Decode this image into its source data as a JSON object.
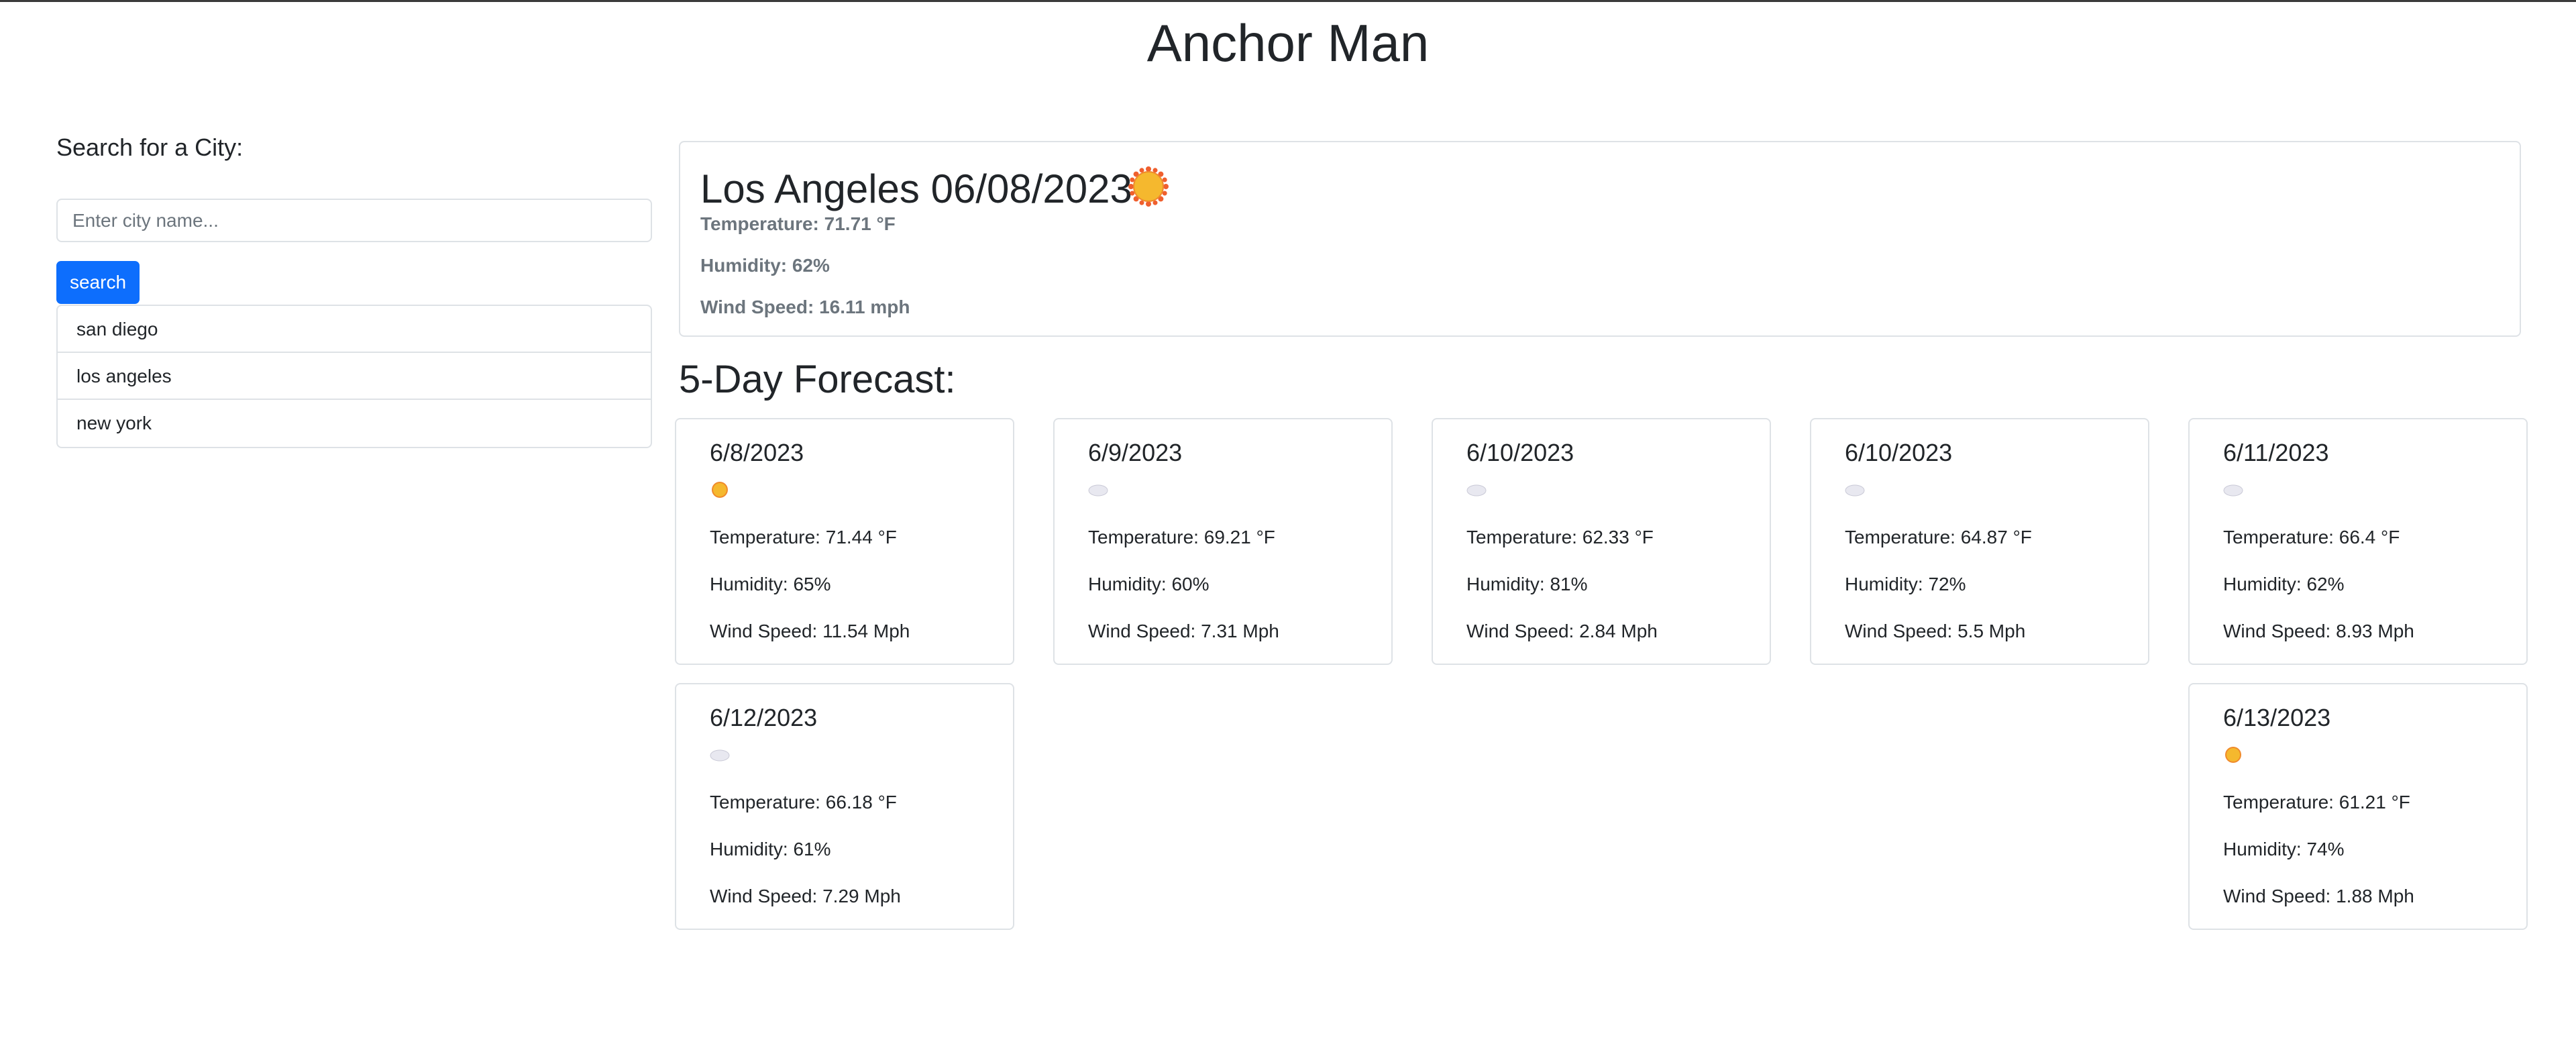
{
  "app": {
    "title": "Anchor Man"
  },
  "sidebar": {
    "heading": "Search for a City:",
    "input_placeholder": "Enter city name...",
    "input_value": "",
    "search_label": "search",
    "history": [
      "san diego",
      "los angeles",
      "new york"
    ]
  },
  "current": {
    "heading": "Los Angeles 06/08/2023",
    "icon": "sun-icon",
    "temperature": "Temperature: 71.71 °F",
    "humidity": "Humidity: 62%",
    "wind": "Wind Speed: 16.11 mph"
  },
  "forecast": {
    "heading": "5-Day Forecast:",
    "days": [
      {
        "date": "6/8/2023",
        "icon": "sun-icon",
        "temperature": "Temperature: 71.44 °F",
        "humidity": "Humidity: 65%",
        "wind": "Wind Speed: 11.54 Mph"
      },
      {
        "date": "6/9/2023",
        "icon": "cloud-icon",
        "temperature": "Temperature: 69.21 °F",
        "humidity": "Humidity: 60%",
        "wind": "Wind Speed: 7.31 Mph"
      },
      {
        "date": "6/10/2023",
        "icon": "cloud-icon",
        "temperature": "Temperature: 62.33 °F",
        "humidity": "Humidity: 81%",
        "wind": "Wind Speed: 2.84 Mph"
      },
      {
        "date": "6/10/2023",
        "icon": "cloud-icon",
        "temperature": "Temperature: 64.87 °F",
        "humidity": "Humidity: 72%",
        "wind": "Wind Speed: 5.5 Mph"
      },
      {
        "date": "6/11/2023",
        "icon": "cloud-icon",
        "temperature": "Temperature: 66.4 °F",
        "humidity": "Humidity: 62%",
        "wind": "Wind Speed: 8.93 Mph"
      },
      {
        "date": "6/12/2023",
        "icon": "cloud-icon",
        "temperature": "Temperature: 66.18 °F",
        "humidity": "Humidity: 61%",
        "wind": "Wind Speed: 7.29 Mph"
      },
      {
        "date": "6/13/2023",
        "icon": "sun-icon",
        "temperature": "Temperature: 61.21 °F",
        "humidity": "Humidity: 74%",
        "wind": "Wind Speed: 1.88 Mph"
      }
    ]
  },
  "colors": {
    "primary": "#0d6efd",
    "border": "#dee2e6",
    "muted": "#6c757d",
    "sun": "#f5b82e",
    "cloud": "#e8e8f0"
  }
}
